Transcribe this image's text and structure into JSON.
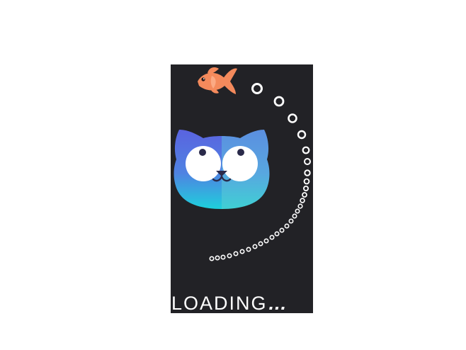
{
  "loader": {
    "text": "LOADING",
    "dots": "...",
    "background_color": "#222226",
    "page_background": "#ffffff",
    "text_color": "#ffffff"
  },
  "icons": {
    "fish": "goldfish-icon",
    "cat": "cat-face-icon",
    "bubbles": "bubble-trail"
  },
  "colors": {
    "fish": "#f48a5c",
    "cat_left": "#5b6fe0",
    "cat_right": "#5e9be0",
    "cat_bottom": "#2fd0d6",
    "eye": "#ffffff",
    "pupil": "#2a2a4a",
    "bubble": "#ffffff"
  }
}
